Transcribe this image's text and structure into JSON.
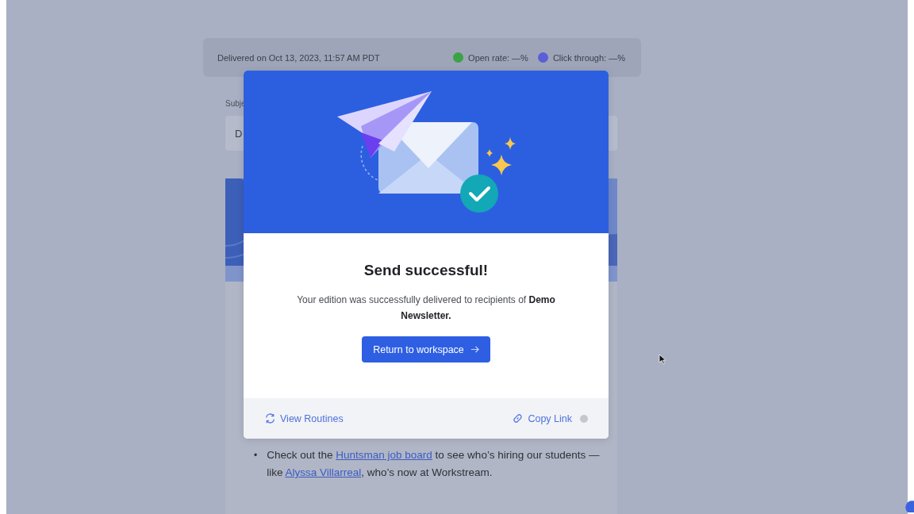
{
  "header": {
    "delivered": "Delivered on Oct 13, 2023, 11:57 AM PDT",
    "stats": [
      {
        "label": "Open rate: —%",
        "color": "#3aa346"
      },
      {
        "label": "Click through: —%",
        "color": "#5b5fd6"
      }
    ]
  },
  "subject_label": "Subje",
  "subject_field": "D",
  "bullet_marker": "•",
  "bullets": [
    [
      {
        "kind": "text",
        "text": "Check out the "
      },
      {
        "kind": "link",
        "text": "Huntsman job board"
      },
      {
        "kind": "text",
        "text": " to see who’s hiring our students — like "
      },
      {
        "kind": "link",
        "text": "Alyssa Villarreal"
      },
      {
        "kind": "text",
        "text": ", who’s now at Workstream."
      }
    ]
  ],
  "modal": {
    "title": "Send successful!",
    "message": "Your edition was successfully delivered to recipients of **Demo Newsletter.**",
    "primary_button": "Return to workspace",
    "footer_links": [
      {
        "label": "View Routines",
        "kind": "routines"
      },
      {
        "label": "Copy Link",
        "kind": "copy"
      }
    ]
  }
}
